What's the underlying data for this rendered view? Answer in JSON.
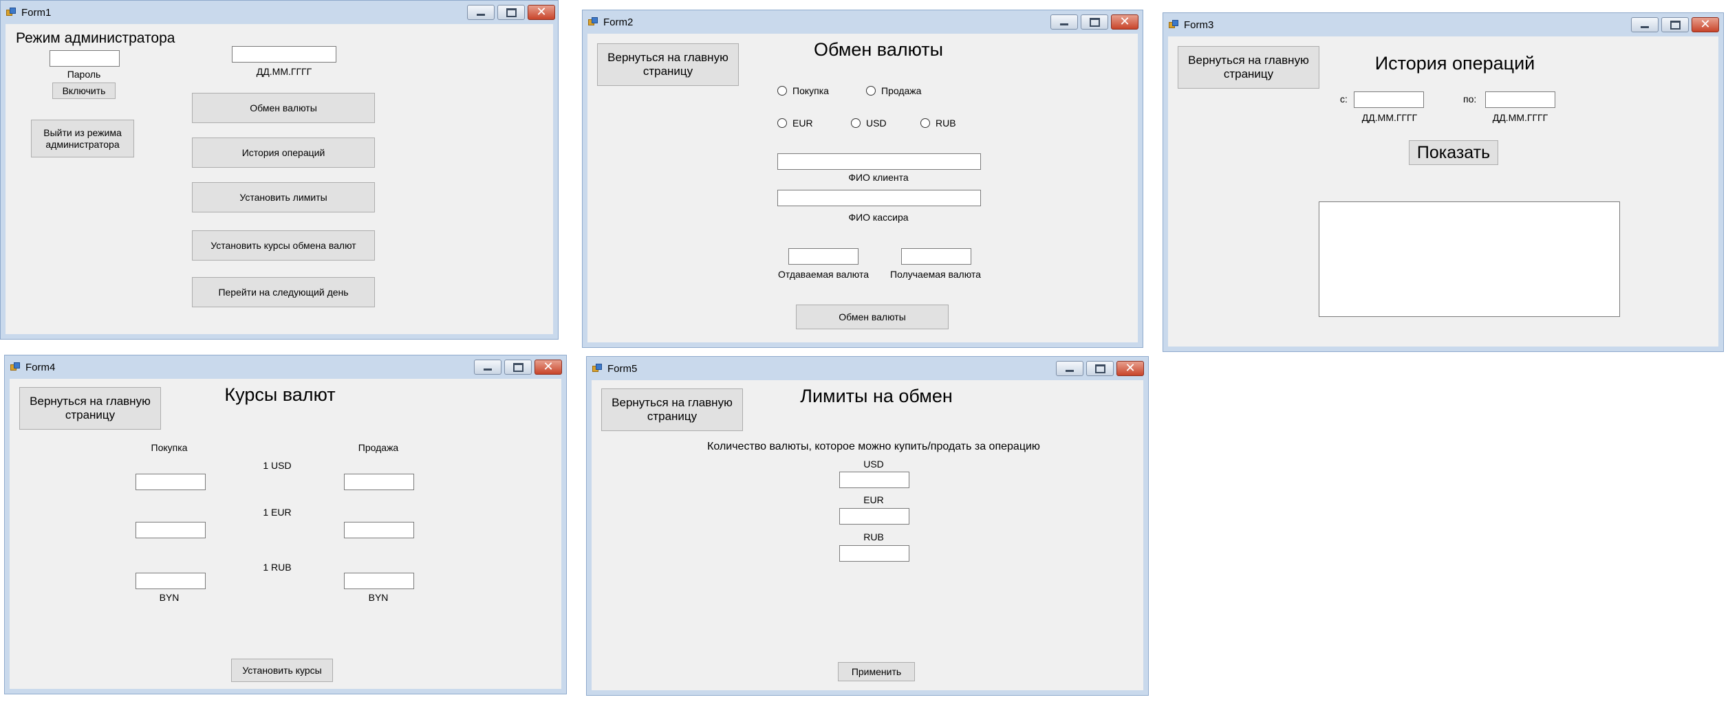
{
  "forms": {
    "form1": {
      "title": "Form1",
      "heading": "Режим администратора",
      "password_label": "Пароль",
      "enable_button": "Включить",
      "exit_admin_button": "Выйти из режима администратора",
      "date_hint": "ДД.ММ.ГГГГ",
      "menu_buttons": [
        "Обмен валюты",
        "История операций",
        "Установить лимиты",
        "Установить курсы обмена валют",
        "Перейти на следующий день"
      ]
    },
    "form2": {
      "title": "Form2",
      "back_button": "Вернуться на главную страницу",
      "heading": "Обмен валюты",
      "operation_options": [
        "Покупка",
        "Продажа"
      ],
      "currency_options": [
        "EUR",
        "USD",
        "RUB"
      ],
      "client_name_label": "ФИО клиента",
      "cashier_name_label": "ФИО кассира",
      "given_currency_label": "Отдаваемая валюта",
      "received_currency_label": "Получаемая валюта",
      "exchange_button": "Обмен валюты"
    },
    "form3": {
      "title": "Form3",
      "back_button": "Вернуться на главную страницу",
      "heading": "История операций",
      "from_label": "с:",
      "to_label": "по:",
      "date_hint": "ДД.ММ.ГГГГ",
      "show_button": "Показать"
    },
    "form4": {
      "title": "Form4",
      "back_button": "Вернуться на главную страницу",
      "heading": "Курсы валют",
      "buy_label": "Покупка",
      "sell_label": "Продажа",
      "currencies": [
        "1 USD",
        "1 EUR",
        "1 RUB"
      ],
      "byn_label": "BYN",
      "set_rates_button": "Установить курсы"
    },
    "form5": {
      "title": "Form5",
      "back_button": "Вернуться на главную страницу",
      "heading": "Лимиты на обмен",
      "description": "Количество валюты, которое можно купить/продать за операцию",
      "currencies": [
        "USD",
        "EUR",
        "RUB"
      ],
      "apply_button": "Применить"
    }
  }
}
